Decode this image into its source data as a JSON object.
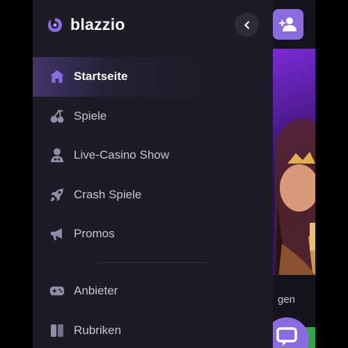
{
  "brand": {
    "name": "blazzio",
    "accent": "#8a6ce0"
  },
  "header": {
    "collapse_icon": "chevron-left-icon",
    "signup_icon": "add-user-icon"
  },
  "nav": {
    "primary": [
      {
        "label": "Startseite",
        "icon": "home-icon",
        "active": true
      },
      {
        "label": "Spiele",
        "icon": "cherries-icon",
        "active": false
      },
      {
        "label": "Live-Casino Show",
        "icon": "dealer-icon",
        "active": false
      },
      {
        "label": "Crash Spiele",
        "icon": "rocket-icon",
        "active": false
      },
      {
        "label": "Promos",
        "icon": "megaphone-icon",
        "active": false
      }
    ],
    "secondary": [
      {
        "label": "Anbieter",
        "icon": "gamepad-icon"
      },
      {
        "label": "Rubriken",
        "icon": "categories-icon"
      }
    ]
  },
  "background": {
    "partial_text": "gen",
    "chat_icon": "chat-icon"
  }
}
